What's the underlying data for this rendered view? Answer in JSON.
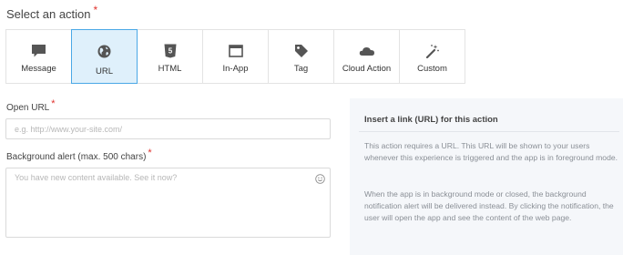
{
  "section": {
    "title": "Select an action",
    "required_mark": "*"
  },
  "actions": [
    {
      "label": "Message",
      "icon": "chat-bubble-icon"
    },
    {
      "label": "URL",
      "icon": "globe-icon",
      "selected": true
    },
    {
      "label": "HTML",
      "icon": "html5-icon"
    },
    {
      "label": "In-App",
      "icon": "window-icon"
    },
    {
      "label": "Tag",
      "icon": "tag-icon"
    },
    {
      "label": "Cloud Action",
      "icon": "cloud-icon"
    },
    {
      "label": "Custom",
      "icon": "magic-wand-icon"
    }
  ],
  "open_url": {
    "label": "Open URL",
    "required_mark": "*",
    "placeholder": "e.g. http://www.your-site.com/",
    "value": ""
  },
  "background_alert": {
    "label": "Background alert (max. 500 chars)",
    "required_mark": "*",
    "placeholder": "You have new content available. See it now?",
    "value": "",
    "emoji_icon": "smiley-icon"
  },
  "help": {
    "title": "Insert a link (URL) for this action",
    "paragraph_1": "This action requires a URL. This URL will be shown to your users whenever this experience is triggered and the app is in foreground mode.",
    "paragraph_2": "When the app is in background mode or closed, the background notification alert will be delivered instead. By clicking the notification, the user will open the app and see the content of the web page."
  },
  "colors": {
    "required": "#e0322d",
    "selected_bg": "#dff0fb",
    "selected_border": "#4aa8e6",
    "icon": "#555555",
    "help_bg": "#f5f7fa"
  }
}
